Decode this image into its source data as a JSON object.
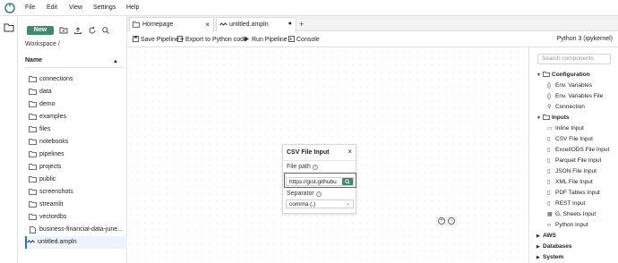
{
  "menu": [
    "File",
    "Edit",
    "View",
    "Settings",
    "Help"
  ],
  "filebrowser": {
    "new_label": "New",
    "workspace": "Workspace /",
    "name_header": "Name",
    "items": [
      {
        "label": "connections",
        "type": "folder"
      },
      {
        "label": "data",
        "type": "folder"
      },
      {
        "label": "demo",
        "type": "folder"
      },
      {
        "label": "examples",
        "type": "folder"
      },
      {
        "label": "files",
        "type": "folder"
      },
      {
        "label": "notebooks",
        "type": "folder"
      },
      {
        "label": "pipelines",
        "type": "folder"
      },
      {
        "label": "projects",
        "type": "folder"
      },
      {
        "label": "public",
        "type": "folder"
      },
      {
        "label": "screenshots",
        "type": "folder"
      },
      {
        "label": "streamlit",
        "type": "folder"
      },
      {
        "label": "vectordbs",
        "type": "folder"
      },
      {
        "label": "business-financial-data-june...",
        "type": "file"
      },
      {
        "label": "untitled.ampln",
        "type": "pipeline"
      }
    ]
  },
  "tabs": [
    {
      "label": "Homepage",
      "close": "×"
    },
    {
      "label": "untitled.ampln",
      "close": "●"
    }
  ],
  "tab_add": "+",
  "toolbar": {
    "save": "Save Pipeline",
    "export": "Export to Python code",
    "run": "Run Pipeline",
    "console": "Console",
    "kernel": "Python 3 (ipykernel)"
  },
  "node": {
    "title": "CSV File Input",
    "close": "×",
    "file_path_label": "File path",
    "file_path_value": "https://gist.githubu",
    "separator_label": "Separator",
    "separator_value": "comma (,)"
  },
  "components": {
    "search_placeholder": "Search components",
    "categories": [
      {
        "label": "Configuration",
        "expanded": true,
        "items": [
          {
            "icon": "{}",
            "label": "Env. Variables"
          },
          {
            "icon": "{}",
            "label": "Env. Variables File"
          },
          {
            "icon": "key",
            "label": "Connection"
          }
        ]
      },
      {
        "label": "Inputs",
        "expanded": true,
        "items": [
          {
            "icon": "▭",
            "label": "Inline Input"
          },
          {
            "icon": "doc",
            "label": "CSV File Input"
          },
          {
            "icon": "doc",
            "label": "Excel/ODS File Input"
          },
          {
            "icon": "doc",
            "label": "Parquet File Input"
          },
          {
            "icon": "doc",
            "label": "JSON File Input"
          },
          {
            "icon": "doc",
            "label": "XML File Input"
          },
          {
            "icon": "doc",
            "label": "PDF Tables Input"
          },
          {
            "icon": "doc",
            "label": "REST Input"
          },
          {
            "icon": "grid",
            "label": "G. Sheets Input"
          },
          {
            "icon": "code",
            "label": "Python Input"
          }
        ]
      },
      {
        "label": "AWS",
        "expanded": false,
        "items": []
      },
      {
        "label": "Databases",
        "expanded": false,
        "items": []
      },
      {
        "label": "System",
        "expanded": false,
        "items": []
      }
    ]
  },
  "colors": {
    "accent": "#3f8a72",
    "highlight": "#d9342b",
    "active_border": "#2a6ee0"
  }
}
